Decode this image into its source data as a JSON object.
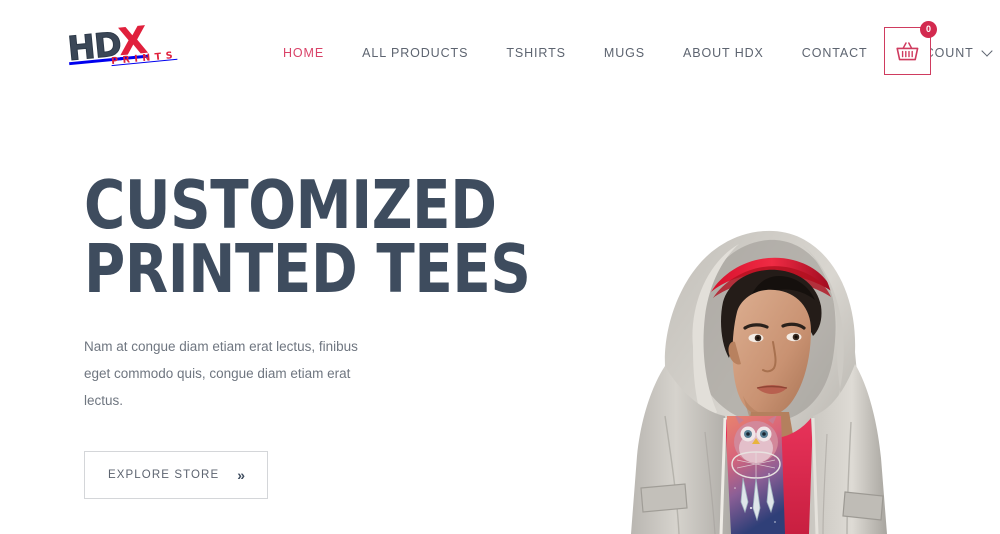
{
  "site": {
    "background": "#ffffff",
    "accent": "#d94268",
    "accent_dark": "#cf3b5f",
    "heading_color": "#3e4c5e",
    "nav_color": "#5d6470"
  },
  "header": {
    "logo": {
      "text_hd": "HD",
      "text_x": "X",
      "text_sub": "PRINTS",
      "name": "hdx-prints-logo"
    },
    "nav": [
      {
        "label": "HOME",
        "active": true
      },
      {
        "label": "ALL PRODUCTS",
        "active": false
      },
      {
        "label": "TSHIRTS",
        "active": false
      },
      {
        "label": "MUGS",
        "active": false
      },
      {
        "label": "ABOUT HDX",
        "active": false
      },
      {
        "label": "CONTACT",
        "active": false
      },
      {
        "label": "ACCOUNT",
        "active": false,
        "has_dropdown": true
      }
    ],
    "cart": {
      "icon": "shopping-basket-icon",
      "count": "0"
    }
  },
  "hero": {
    "title_line1": "CUSTOMIZED",
    "title_line2": "PRINTED TEES",
    "subtitle": "Nam at congue diam etiam erat lectus, finibus eget commodo quis, congue diam etiam erat lectus.",
    "cta": {
      "label": "EXPLORE STORE",
      "arrow": "»"
    },
    "image": {
      "name": "hero-model-photo",
      "description": "Young man wearing a light gray hooded jacket over a red t-shirt with a cosmic owl dreamcatcher print, and a red-brimmed cap under the hood"
    }
  }
}
